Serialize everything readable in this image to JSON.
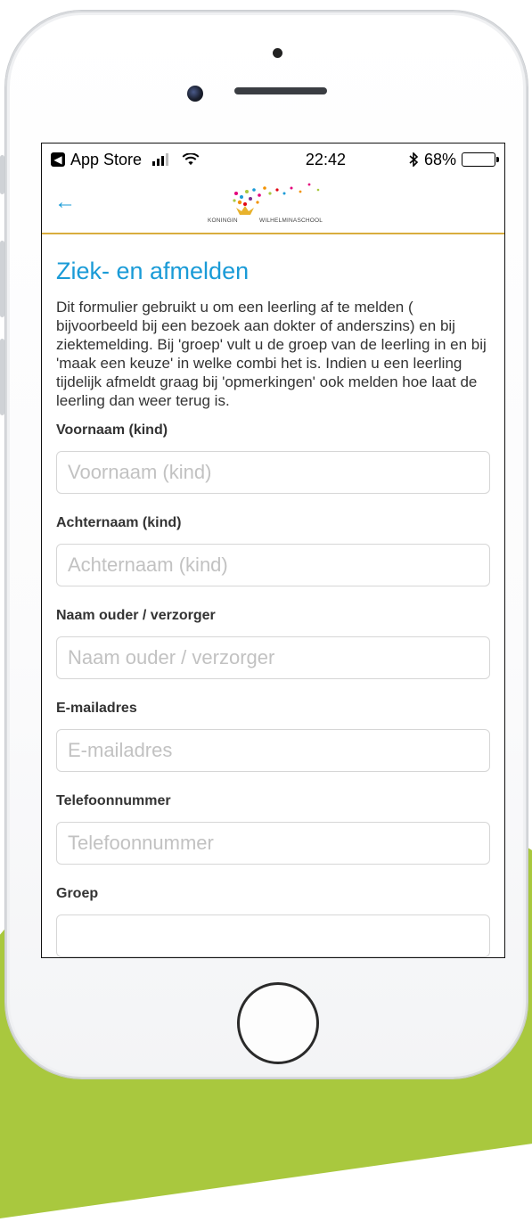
{
  "status_bar": {
    "back_app_label": "App Store",
    "time": "22:42",
    "bluetooth_icon": "bluetooth-icon",
    "battery_percent": "68%",
    "battery_level": 0.68
  },
  "header": {
    "back_icon": "back-arrow-icon",
    "logo": {
      "text_left": "KONINGIN",
      "text_right": "WILHELMINASCHOOL"
    }
  },
  "page": {
    "title": "Ziek- en afmelden",
    "intro": "Dit formulier gebruikt u om een leerling af te melden ( bijvoorbeeld bij een bezoek aan dokter of anderszins) en bij ziektemelding. Bij 'groep' vult u de groep van de leerling in en bij 'maak een keuze' in welke combi het is. Indien u een leerling tijdelijk afmeldt graag bij 'opmerkingen' ook melden hoe laat de leerling dan weer terug is."
  },
  "form": {
    "fields": [
      {
        "label": "Voornaam (kind)",
        "placeholder": "Voornaam (kind)"
      },
      {
        "label": "Achternaam (kind)",
        "placeholder": "Achternaam (kind)"
      },
      {
        "label": "Naam ouder / verzorger",
        "placeholder": "Naam ouder / verzorger"
      },
      {
        "label": "E-mailadres",
        "placeholder": "E-mailadres"
      },
      {
        "label": "Telefoonnummer",
        "placeholder": "Telefoonnummer"
      }
    ],
    "group_label": "Groep"
  },
  "colors": {
    "accent_blue": "#1a9bd7",
    "header_rule": "#d9ad3e",
    "background_green": "#a9c83e"
  }
}
